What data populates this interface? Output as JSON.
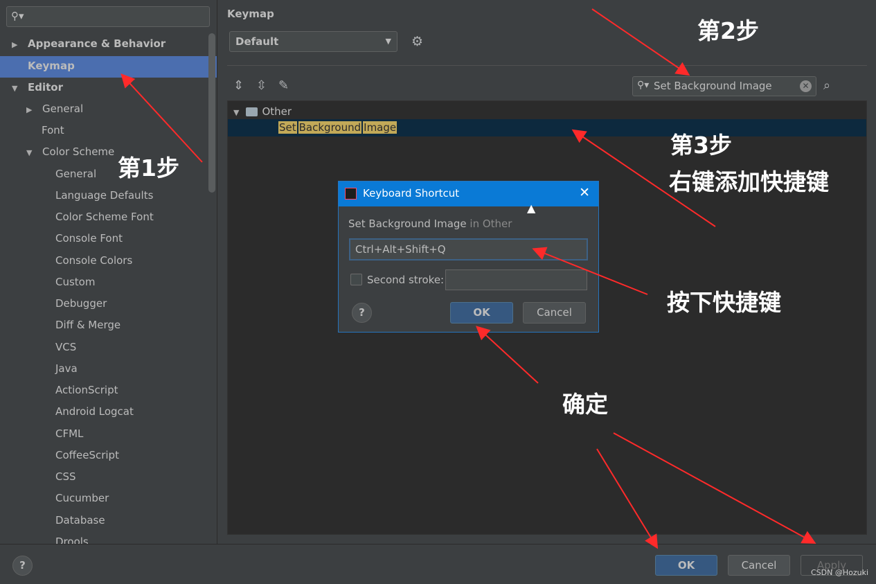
{
  "sidebar": {
    "search_icon": "search-icon",
    "items": [
      {
        "label": "Appearance & Behavior",
        "arrow": "▶"
      },
      {
        "label": "Keymap",
        "arrow": ""
      },
      {
        "label": "Editor",
        "arrow": "▼"
      },
      {
        "label": "General",
        "arrow": "▶"
      },
      {
        "label": "Font",
        "arrow": ""
      },
      {
        "label": "Color Scheme",
        "arrow": "▼"
      },
      {
        "label": "General",
        "arrow": ""
      },
      {
        "label": "Language Defaults",
        "arrow": ""
      },
      {
        "label": "Color Scheme Font",
        "arrow": ""
      },
      {
        "label": "Console Font",
        "arrow": ""
      },
      {
        "label": "Console Colors",
        "arrow": ""
      },
      {
        "label": "Custom",
        "arrow": ""
      },
      {
        "label": "Debugger",
        "arrow": ""
      },
      {
        "label": "Diff & Merge",
        "arrow": ""
      },
      {
        "label": "VCS",
        "arrow": ""
      },
      {
        "label": "Java",
        "arrow": ""
      },
      {
        "label": "ActionScript",
        "arrow": ""
      },
      {
        "label": "Android Logcat",
        "arrow": ""
      },
      {
        "label": "CFML",
        "arrow": ""
      },
      {
        "label": "CoffeeScript",
        "arrow": ""
      },
      {
        "label": "CSS",
        "arrow": ""
      },
      {
        "label": "Cucumber",
        "arrow": ""
      },
      {
        "label": "Database",
        "arrow": ""
      },
      {
        "label": "Drools",
        "arrow": ""
      }
    ]
  },
  "main": {
    "title": "Keymap",
    "scheme": "Default",
    "filter_value": "Set Background Image",
    "tree": {
      "group": "Other",
      "action_words": [
        "Set",
        "Background",
        "Image"
      ]
    }
  },
  "dialog": {
    "title": "Keyboard Shortcut",
    "desc_action": "Set Background Image",
    "desc_in": " in Other",
    "first_stroke": "Ctrl+Alt+Shift+Q",
    "second_stroke_label": "Second stroke:",
    "help": "?",
    "ok": "OK",
    "cancel": "Cancel"
  },
  "footer": {
    "help": "?",
    "ok": "OK",
    "cancel": "Cancel",
    "apply": "Apply",
    "watermark": "CSDN @Hozuki"
  },
  "annotations": {
    "step1": "第1步",
    "step2": "第2步",
    "step3": "第3步",
    "step3_sub": "右键添加快捷键",
    "press": "按下快捷键",
    "confirm": "确定",
    "color": "#ff2a2a"
  }
}
